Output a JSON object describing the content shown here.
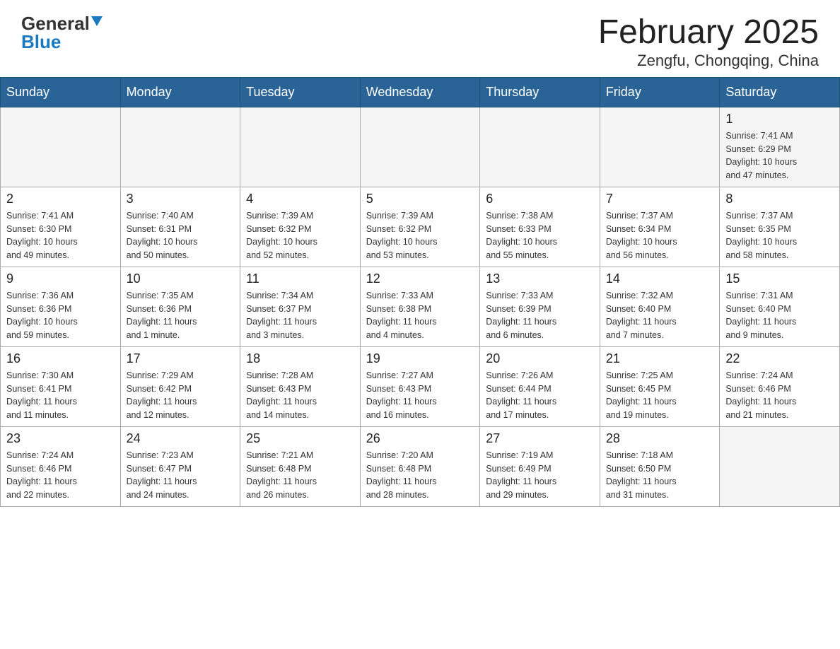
{
  "header": {
    "logo_general": "General",
    "logo_blue": "Blue",
    "month_title": "February 2025",
    "location": "Zengfu, Chongqing, China"
  },
  "days_of_week": [
    "Sunday",
    "Monday",
    "Tuesday",
    "Wednesday",
    "Thursday",
    "Friday",
    "Saturday"
  ],
  "weeks": [
    {
      "days": [
        {
          "num": "",
          "info": ""
        },
        {
          "num": "",
          "info": ""
        },
        {
          "num": "",
          "info": ""
        },
        {
          "num": "",
          "info": ""
        },
        {
          "num": "",
          "info": ""
        },
        {
          "num": "",
          "info": ""
        },
        {
          "num": "1",
          "info": "Sunrise: 7:41 AM\nSunset: 6:29 PM\nDaylight: 10 hours\nand 47 minutes."
        }
      ]
    },
    {
      "days": [
        {
          "num": "2",
          "info": "Sunrise: 7:41 AM\nSunset: 6:30 PM\nDaylight: 10 hours\nand 49 minutes."
        },
        {
          "num": "3",
          "info": "Sunrise: 7:40 AM\nSunset: 6:31 PM\nDaylight: 10 hours\nand 50 minutes."
        },
        {
          "num": "4",
          "info": "Sunrise: 7:39 AM\nSunset: 6:32 PM\nDaylight: 10 hours\nand 52 minutes."
        },
        {
          "num": "5",
          "info": "Sunrise: 7:39 AM\nSunset: 6:32 PM\nDaylight: 10 hours\nand 53 minutes."
        },
        {
          "num": "6",
          "info": "Sunrise: 7:38 AM\nSunset: 6:33 PM\nDaylight: 10 hours\nand 55 minutes."
        },
        {
          "num": "7",
          "info": "Sunrise: 7:37 AM\nSunset: 6:34 PM\nDaylight: 10 hours\nand 56 minutes."
        },
        {
          "num": "8",
          "info": "Sunrise: 7:37 AM\nSunset: 6:35 PM\nDaylight: 10 hours\nand 58 minutes."
        }
      ]
    },
    {
      "days": [
        {
          "num": "9",
          "info": "Sunrise: 7:36 AM\nSunset: 6:36 PM\nDaylight: 10 hours\nand 59 minutes."
        },
        {
          "num": "10",
          "info": "Sunrise: 7:35 AM\nSunset: 6:36 PM\nDaylight: 11 hours\nand 1 minute."
        },
        {
          "num": "11",
          "info": "Sunrise: 7:34 AM\nSunset: 6:37 PM\nDaylight: 11 hours\nand 3 minutes."
        },
        {
          "num": "12",
          "info": "Sunrise: 7:33 AM\nSunset: 6:38 PM\nDaylight: 11 hours\nand 4 minutes."
        },
        {
          "num": "13",
          "info": "Sunrise: 7:33 AM\nSunset: 6:39 PM\nDaylight: 11 hours\nand 6 minutes."
        },
        {
          "num": "14",
          "info": "Sunrise: 7:32 AM\nSunset: 6:40 PM\nDaylight: 11 hours\nand 7 minutes."
        },
        {
          "num": "15",
          "info": "Sunrise: 7:31 AM\nSunset: 6:40 PM\nDaylight: 11 hours\nand 9 minutes."
        }
      ]
    },
    {
      "days": [
        {
          "num": "16",
          "info": "Sunrise: 7:30 AM\nSunset: 6:41 PM\nDaylight: 11 hours\nand 11 minutes."
        },
        {
          "num": "17",
          "info": "Sunrise: 7:29 AM\nSunset: 6:42 PM\nDaylight: 11 hours\nand 12 minutes."
        },
        {
          "num": "18",
          "info": "Sunrise: 7:28 AM\nSunset: 6:43 PM\nDaylight: 11 hours\nand 14 minutes."
        },
        {
          "num": "19",
          "info": "Sunrise: 7:27 AM\nSunset: 6:43 PM\nDaylight: 11 hours\nand 16 minutes."
        },
        {
          "num": "20",
          "info": "Sunrise: 7:26 AM\nSunset: 6:44 PM\nDaylight: 11 hours\nand 17 minutes."
        },
        {
          "num": "21",
          "info": "Sunrise: 7:25 AM\nSunset: 6:45 PM\nDaylight: 11 hours\nand 19 minutes."
        },
        {
          "num": "22",
          "info": "Sunrise: 7:24 AM\nSunset: 6:46 PM\nDaylight: 11 hours\nand 21 minutes."
        }
      ]
    },
    {
      "days": [
        {
          "num": "23",
          "info": "Sunrise: 7:24 AM\nSunset: 6:46 PM\nDaylight: 11 hours\nand 22 minutes."
        },
        {
          "num": "24",
          "info": "Sunrise: 7:23 AM\nSunset: 6:47 PM\nDaylight: 11 hours\nand 24 minutes."
        },
        {
          "num": "25",
          "info": "Sunrise: 7:21 AM\nSunset: 6:48 PM\nDaylight: 11 hours\nand 26 minutes."
        },
        {
          "num": "26",
          "info": "Sunrise: 7:20 AM\nSunset: 6:48 PM\nDaylight: 11 hours\nand 28 minutes."
        },
        {
          "num": "27",
          "info": "Sunrise: 7:19 AM\nSunset: 6:49 PM\nDaylight: 11 hours\nand 29 minutes."
        },
        {
          "num": "28",
          "info": "Sunrise: 7:18 AM\nSunset: 6:50 PM\nDaylight: 11 hours\nand 31 minutes."
        },
        {
          "num": "",
          "info": ""
        }
      ]
    }
  ]
}
